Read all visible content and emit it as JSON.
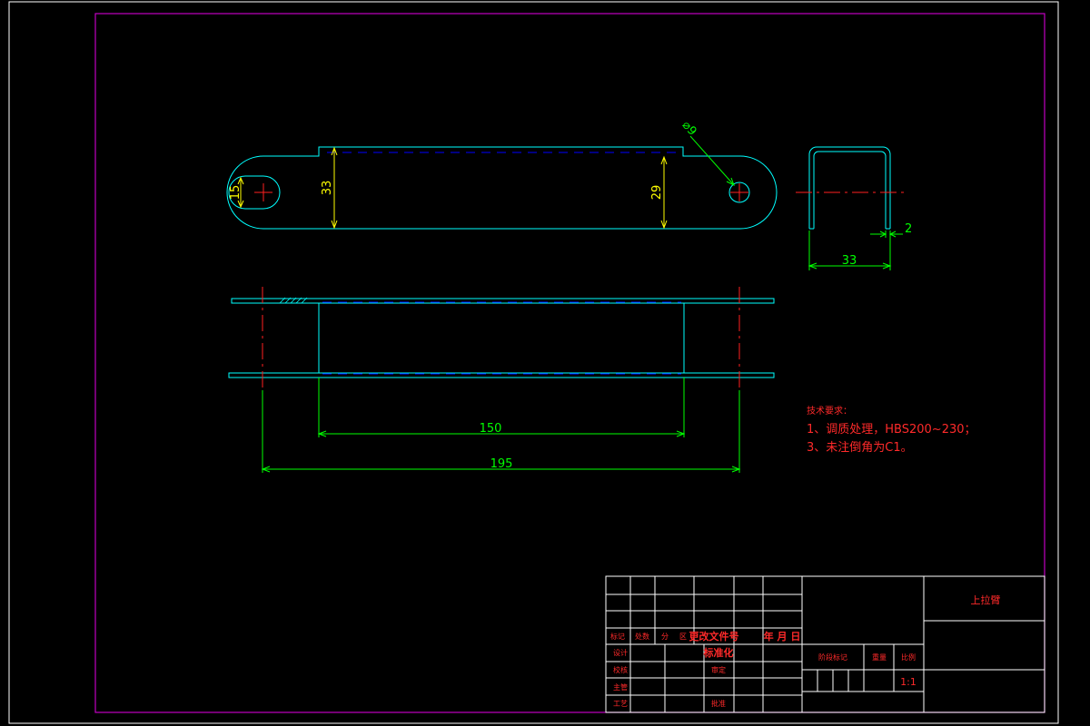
{
  "dimensions": {
    "d_15": "15",
    "d_33_height": "33",
    "d_29": "29",
    "d_diameter_hole": "⌀9",
    "d_2": "2",
    "d_33_width": "33",
    "d_150": "150",
    "d_195": "195"
  },
  "notes": {
    "title": "技术要求：",
    "line1": "1、调质处理，HBS200~230；",
    "line2": "3、未注倒角为C1。"
  },
  "title_block": {
    "part_name": "上拉臂",
    "scale": "1:1",
    "labels": {
      "mark": "标记",
      "count": "处数",
      "zone": "分",
      "zone2": "区",
      "change_doc": "更改文件号",
      "date": "年 月 日",
      "design": "设计",
      "standardize": "标准化",
      "check": "校核",
      "review": "审定",
      "supervisor": "主管",
      "process": "工艺",
      "approve": "批准",
      "stage_mark": "阶段标记",
      "weight": "重量",
      "scale_label": "比例"
    }
  },
  "colors": {
    "frame": "#c000c0",
    "outline": "#00ffff",
    "hidden": "#0000ff",
    "center": "#ff0000",
    "dim_yellow": "#ffff00",
    "dim_green": "#00ff00",
    "white": "#ffffff"
  }
}
